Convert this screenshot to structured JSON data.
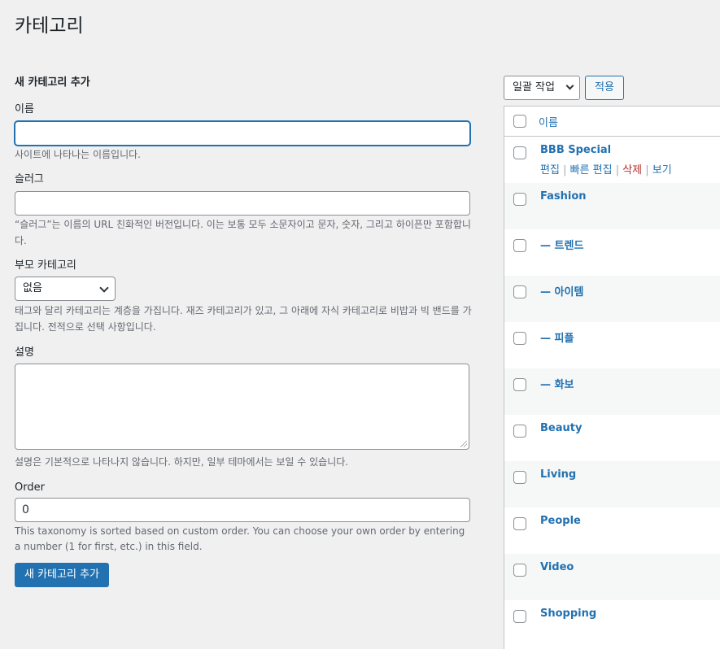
{
  "page": {
    "title": "카테고리"
  },
  "form": {
    "heading": "새 카테고리 추가",
    "name": {
      "label": "이름",
      "value": "",
      "help": "사이트에 나타나는 이름입니다."
    },
    "slug": {
      "label": "슬러그",
      "value": "",
      "help": "“슬러그”는 이름의 URL 친화적인 버전입니다. 이는 보통 모두 소문자이고 문자, 숫자, 그리고 하이픈만 포함합니다."
    },
    "parent": {
      "label": "부모 카테고리",
      "selected": "없음",
      "help": "태그와 달리 카테고리는 계층을 가집니다. 재즈 카테고리가 있고, 그 아래에 자식 카테고리로 비밥과 빅 밴드를 가집니다. 전적으로 선택 사항입니다."
    },
    "description": {
      "label": "설명",
      "value": "",
      "help": "설명은 기본적으로 나타나지 않습니다. 하지만, 일부 테마에서는 보일 수 있습니다."
    },
    "order": {
      "label": "Order",
      "value": "0",
      "help": "This taxonomy is sorted based on custom order. You can choose your own order by entering a number (1 for first, etc.) in this field."
    },
    "submit_label": "새 카테고리 추가"
  },
  "list": {
    "bulk_action": "일괄 작업",
    "apply_label": "적용",
    "column_name": "이름",
    "row_actions": {
      "edit": "편집",
      "quick_edit": "빠른 편집",
      "delete": "삭제",
      "view": "보기"
    },
    "rows": [
      {
        "name": "BBB Special"
      },
      {
        "name": "Fashion"
      },
      {
        "name": "— 트렌드"
      },
      {
        "name": "— 아이템"
      },
      {
        "name": "— 피플"
      },
      {
        "name": "— 화보"
      },
      {
        "name": "Beauty"
      },
      {
        "name": "Living"
      },
      {
        "name": "People"
      },
      {
        "name": "Video"
      },
      {
        "name": "Shopping"
      }
    ]
  },
  "colors": {
    "accent": "#2271b1",
    "danger": "#b32d2e",
    "background": "#f0f0f1"
  }
}
